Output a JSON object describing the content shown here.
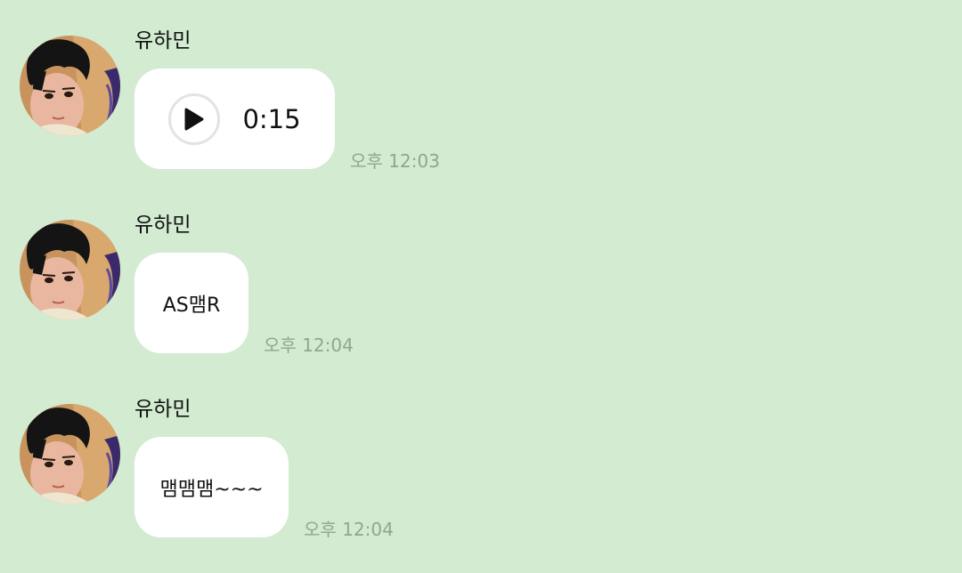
{
  "messages": [
    {
      "sender": "유하민",
      "type": "voice",
      "duration": "0:15",
      "time": "오후 12:03",
      "avatar_icon": "profile-illustration-icon"
    },
    {
      "sender": "유하민",
      "type": "text",
      "text": "AS맴R",
      "time": "오후 12:04",
      "avatar_icon": "profile-illustration-icon"
    },
    {
      "sender": "유하민",
      "type": "text",
      "text": "맴맴맴~~~",
      "time": "오후 12:04",
      "avatar_icon": "profile-illustration-icon"
    }
  ],
  "colors": {
    "background": "#d2ebd1",
    "bubble": "#ffffff",
    "time_text": "#8fa78f"
  }
}
